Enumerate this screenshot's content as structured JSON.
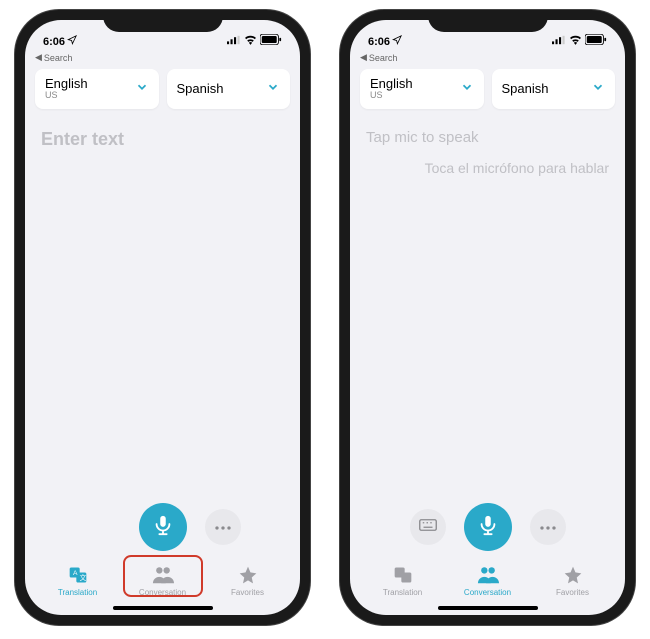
{
  "status": {
    "time": "6:06",
    "back_label": "Search"
  },
  "left": {
    "lang1": {
      "name": "English",
      "region": "US"
    },
    "lang2": {
      "name": "Spanish",
      "region": ""
    },
    "placeholder": "Enter text",
    "tabs": {
      "translation": "Translation",
      "conversation": "Conversation",
      "favorites": "Favorites"
    },
    "active_tab": "translation",
    "highlight_tab": "conversation"
  },
  "right": {
    "lang1": {
      "name": "English",
      "region": "US"
    },
    "lang2": {
      "name": "Spanish",
      "region": ""
    },
    "prompt_primary": "Tap mic to speak",
    "prompt_secondary": "Toca el micrófono para hablar",
    "tabs": {
      "translation": "Translation",
      "conversation": "Conversation",
      "favorites": "Favorites"
    },
    "active_tab": "conversation"
  },
  "colors": {
    "accent": "#2aa9c9",
    "highlight": "#d03a2a"
  }
}
